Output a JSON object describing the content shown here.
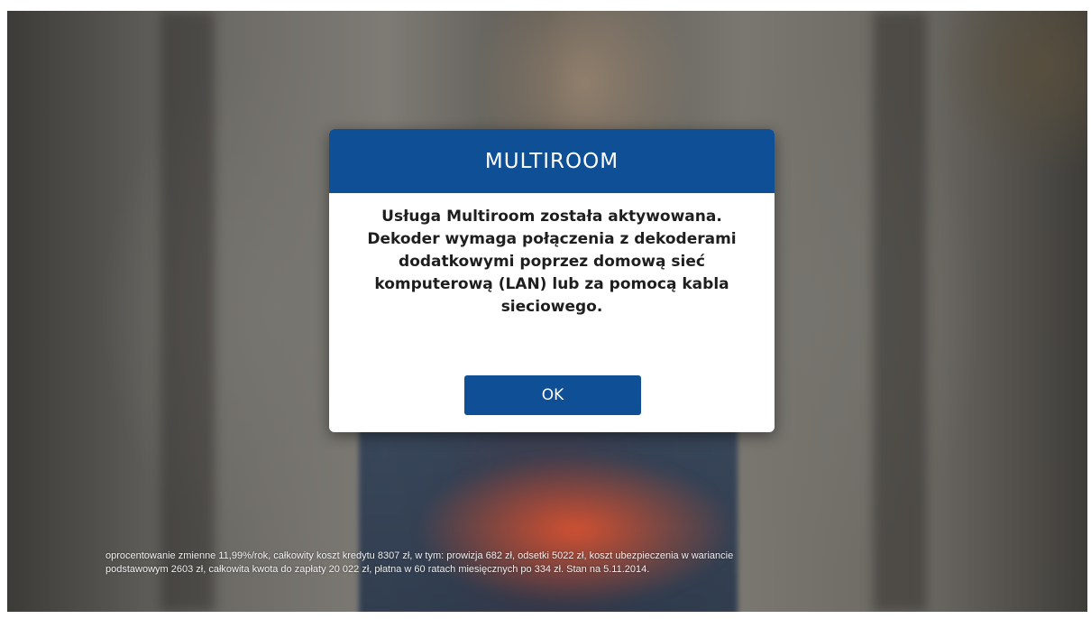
{
  "dialog": {
    "title": "MULTIROOM",
    "message_lines": [
      "Usługa Multiroom została aktywowana.",
      "Dekoder wymaga połączenia z dekoderami",
      "dodatkowymi poprzez domową sieć",
      "komputerową (LAN) lub za pomocą kabla",
      "sieciowego."
    ],
    "ok_label": "OK"
  },
  "background": {
    "disclaimer_lines": [
      "oprocentowanie zmienne 11,99%/rok, całkowity koszt kredytu 8307 zł, w tym: prowizja 682 zł, odsetki 5022 zł, koszt ubezpieczenia w wariancie",
      "podstawowym 2603 zł, całkowita kwota do zapłaty 20 022 zł, płatna w 60 ratach miesięcznych po 334 zł. Stan na 5.11.2014."
    ]
  },
  "colors": {
    "header_blue": "#0f4f95",
    "button_blue": "#0f4f95",
    "dialog_bg": "#ffffff",
    "message_text": "#1e1e1e"
  }
}
